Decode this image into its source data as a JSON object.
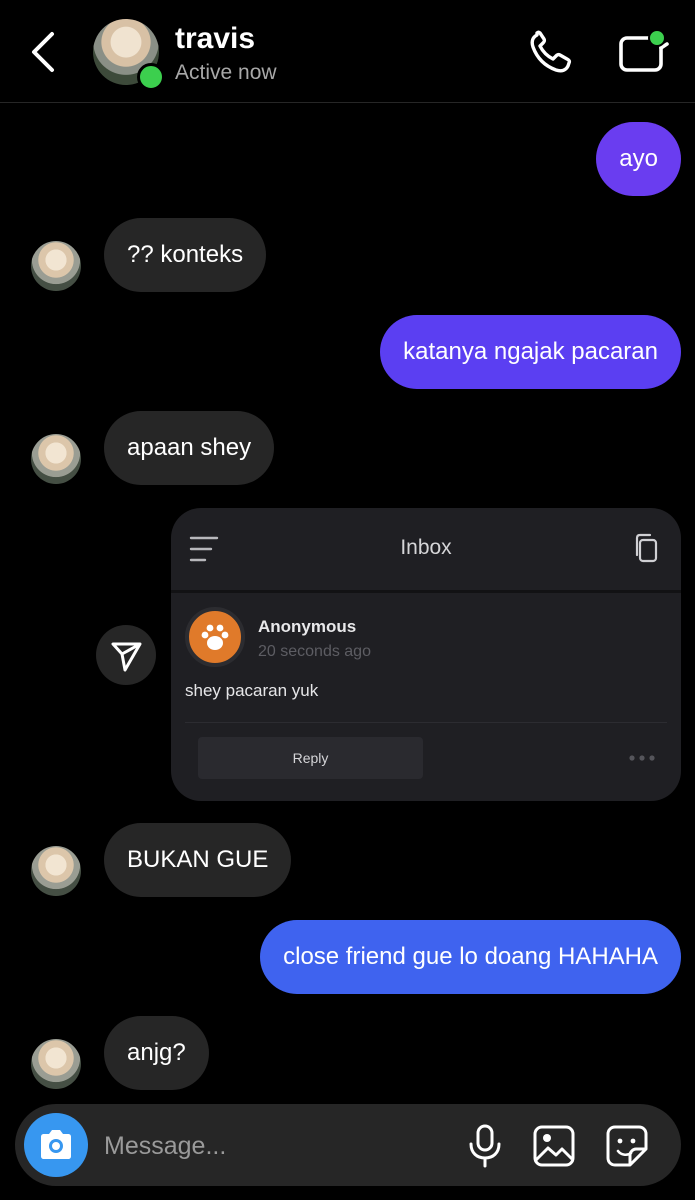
{
  "header": {
    "name": "travis",
    "status": "Active now",
    "online_color": "#3ccf4e",
    "icons": [
      "back-arrow-icon",
      "phone-icon",
      "video-camera-icon"
    ]
  },
  "messages": [
    {
      "from": "me",
      "text": "ayo",
      "color": "#6a3df0"
    },
    {
      "from": "travis",
      "text": "?? konteks"
    },
    {
      "from": "me",
      "text": "katanya ngajak pacaran",
      "color": "#5b3ff2"
    },
    {
      "from": "travis",
      "text": "apaan shey"
    },
    {
      "from": "travis",
      "text": "BUKAN GUE"
    },
    {
      "from": "me",
      "text": "close friend gue lo doang HAHAHA",
      "color": "#3f63ef"
    },
    {
      "from": "travis",
      "text": "anjg?"
    }
  ],
  "shared_card": {
    "title": "Inbox",
    "sender": "Anonymous",
    "time": "20 seconds ago",
    "message": "shey pacaran yuk",
    "reply_label": "Reply",
    "avatar_color": "#e07a2a"
  },
  "composer": {
    "placeholder": "Message...",
    "camera_color": "#3797f0",
    "icons": [
      "camera-icon",
      "microphone-icon",
      "gallery-icon",
      "sticker-icon"
    ]
  }
}
